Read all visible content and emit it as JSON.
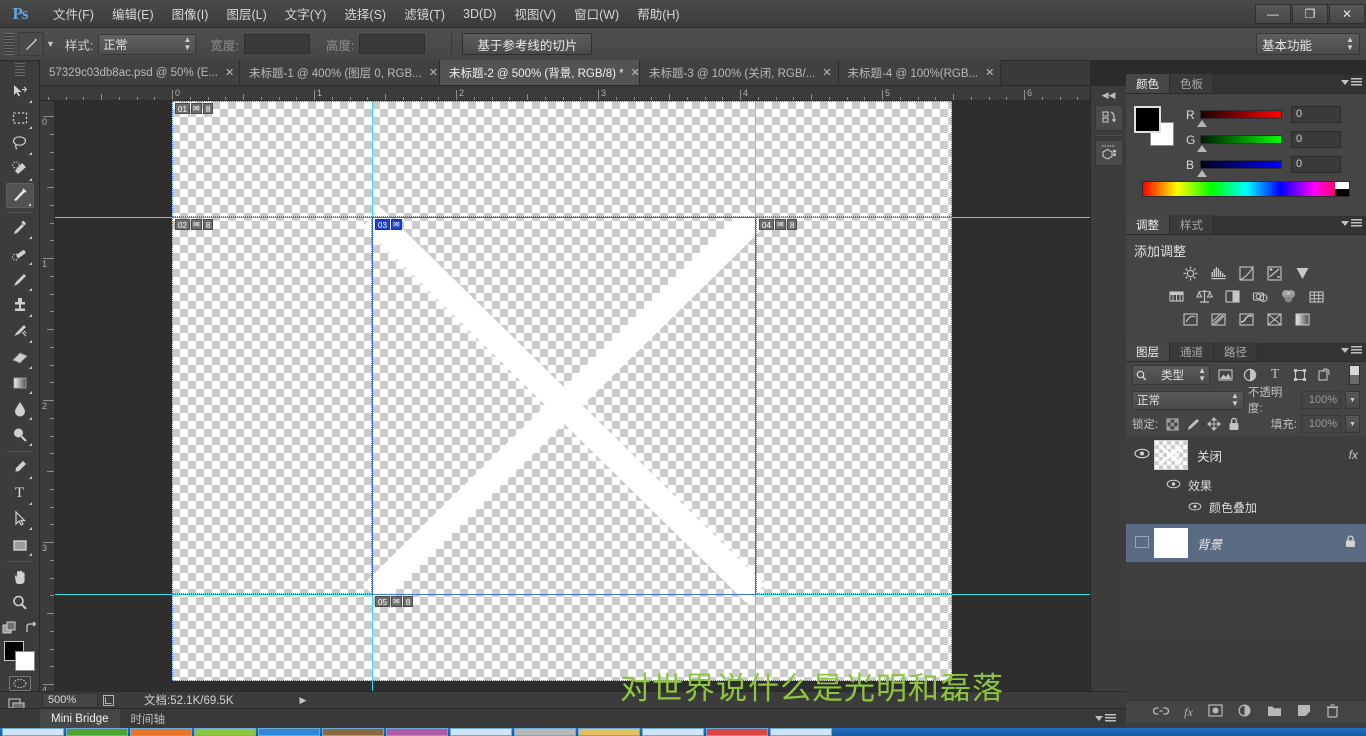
{
  "app": {
    "logo": "Ps",
    "title": "Adobe Photoshop"
  },
  "window_controls": {
    "minimize": "—",
    "restore": "❐",
    "close": "✕"
  },
  "menu": [
    {
      "label": "文件(F)"
    },
    {
      "label": "编辑(E)"
    },
    {
      "label": "图像(I)"
    },
    {
      "label": "图层(L)"
    },
    {
      "label": "文字(Y)"
    },
    {
      "label": "选择(S)"
    },
    {
      "label": "滤镜(T)"
    },
    {
      "label": "3D(D)"
    },
    {
      "label": "视图(V)"
    },
    {
      "label": "窗口(W)"
    },
    {
      "label": "帮助(H)"
    }
  ],
  "options_bar": {
    "style_label": "样式:",
    "style_value": "正常",
    "width_label": "宽度:",
    "width_value": "",
    "height_label": "高度:",
    "height_value": "",
    "slices_from_guides": "基于参考线的切片",
    "workspace": "基本功能"
  },
  "tabs": [
    {
      "label": "57329c03db8ac.psd @ 50% (E...",
      "active": false
    },
    {
      "label": "未标题-1 @ 400% (图层 0, RGB...",
      "active": false
    },
    {
      "label": "未标题-2 @ 500% (背景, RGB/8) *",
      "active": true
    },
    {
      "label": "未标题-3 @ 100% (关闭, RGB/...",
      "active": false
    },
    {
      "label": "未标题-4 @ 100%(RGB...",
      "active": false
    }
  ],
  "toolbar": [
    {
      "name": "move-tool",
      "glyph": "✥",
      "active": false
    },
    {
      "name": "marquee-tool",
      "glyph": "▭",
      "active": false
    },
    {
      "name": "lasso-tool",
      "glyph": "◯",
      "active": false
    },
    {
      "name": "quick-selection-tool",
      "glyph": "✧",
      "active": false
    },
    {
      "name": "slice-tool",
      "glyph": "✂",
      "active": true
    },
    {
      "name": "eyedropper-tool",
      "glyph": "⌖",
      "active": false
    },
    {
      "name": "healing-brush-tool",
      "glyph": "✒",
      "active": false
    },
    {
      "name": "brush-tool",
      "glyph": "🖌",
      "active": false
    },
    {
      "name": "clone-stamp-tool",
      "glyph": "⎙",
      "active": false
    },
    {
      "name": "history-brush-tool",
      "glyph": "⤳",
      "active": false
    },
    {
      "name": "eraser-tool",
      "glyph": "▱",
      "active": false
    },
    {
      "name": "gradient-tool",
      "glyph": "▦",
      "active": false
    },
    {
      "name": "blur-tool",
      "glyph": "💧",
      "active": false
    },
    {
      "name": "dodge-tool",
      "glyph": "🔍",
      "active": false
    },
    {
      "name": "pen-tool",
      "glyph": "✎",
      "active": false
    },
    {
      "name": "type-tool",
      "glyph": "T",
      "active": false
    },
    {
      "name": "path-selection-tool",
      "glyph": "➤",
      "active": false
    },
    {
      "name": "rectangle-tool",
      "glyph": "▣",
      "active": false
    },
    {
      "name": "hand-tool",
      "glyph": "✋",
      "active": false
    },
    {
      "name": "zoom-tool",
      "glyph": "🔎",
      "active": false
    }
  ],
  "canvas": {
    "ruler_h_labels": [
      "0",
      "1",
      "2",
      "3",
      "4",
      "5",
      "6"
    ],
    "ruler_v_labels": [
      "0",
      "1",
      "2",
      "3",
      "4"
    ],
    "slices": [
      {
        "number": "01",
        "link": "8",
        "selected": false
      },
      {
        "number": "02",
        "link": "8",
        "selected": false
      },
      {
        "number": "03",
        "link": "",
        "selected": true
      },
      {
        "number": "04",
        "link": "8",
        "selected": false
      },
      {
        "number": "05",
        "link": "8",
        "selected": false
      }
    ],
    "overlay_text": "对世界说什么是光明和磊落",
    "overlay_color": "#8cc63e"
  },
  "mini_dock": [
    {
      "name": "history-panel-icon",
      "glyph": "↺"
    },
    {
      "name": "3d-panel-icon",
      "glyph": "▣"
    }
  ],
  "color_panel": {
    "tabs": [
      {
        "label": "颜色",
        "active": true
      },
      {
        "label": "色板",
        "active": false
      }
    ],
    "channels": [
      {
        "label": "R",
        "value": "0",
        "gradient_from": "#1a0000",
        "gradient_to": "#ff0000"
      },
      {
        "label": "G",
        "value": "0",
        "gradient_from": "#001a00",
        "gradient_to": "#00ff00"
      },
      {
        "label": "B",
        "value": "0",
        "gradient_from": "#00001a",
        "gradient_to": "#0000ff"
      }
    ],
    "foreground": "#000000",
    "background": "#ffffff"
  },
  "adjustments_panel": {
    "tabs": [
      {
        "label": "调整",
        "active": true
      },
      {
        "label": "样式",
        "active": false
      }
    ],
    "title": "添加调整",
    "icons": [
      [
        "brightness-contrast-icon",
        "levels-icon",
        "curves-icon",
        "exposure-icon",
        "vibrance-icon"
      ],
      [
        "hue-saturation-icon",
        "color-balance-icon",
        "black-white-icon",
        "photo-filter-icon",
        "channel-mixer-icon",
        "color-lookup-icon"
      ],
      [
        "invert-icon",
        "posterize-icon",
        "threshold-icon",
        "selective-color-icon",
        "gradient-map-icon"
      ]
    ]
  },
  "layers_panel": {
    "tabs": [
      {
        "label": "图层",
        "active": true
      },
      {
        "label": "通道",
        "active": false
      },
      {
        "label": "路径",
        "active": false
      }
    ],
    "filter_label": "类型",
    "filter_icons": [
      "pixel-filter-icon",
      "adjustment-filter-icon",
      "type-filter-icon",
      "shape-filter-icon",
      "smart-object-filter-icon"
    ],
    "blend_mode": "正常",
    "opacity_label": "不透明度:",
    "opacity_value": "100%",
    "lock_label": "锁定:",
    "fill_label": "填充:",
    "fill_value": "100%",
    "lock_icons": [
      "lock-transparency-icon",
      "lock-image-icon",
      "lock-position-icon",
      "lock-all-icon"
    ],
    "layers": [
      {
        "name": "关闭",
        "visible": true,
        "selected": false,
        "has_fx": true,
        "fx_label": "fx",
        "effects_label": "效果",
        "effect_items": [
          "颜色叠加"
        ]
      },
      {
        "name": "背景",
        "visible": false,
        "selected": true,
        "locked": true,
        "italic": true
      }
    ],
    "footer_icons": [
      "link-layers-icon",
      "add-style-icon",
      "add-mask-icon",
      "new-adjustment-icon",
      "new-group-icon",
      "new-layer-icon",
      "delete-layer-icon"
    ]
  },
  "status_bar": {
    "zoom": "500%",
    "doc_info": "文档:52.1K/69.5K",
    "bottom_tabs": [
      {
        "label": "Mini Bridge",
        "active": true
      },
      {
        "label": "时间轴",
        "active": false
      }
    ]
  }
}
